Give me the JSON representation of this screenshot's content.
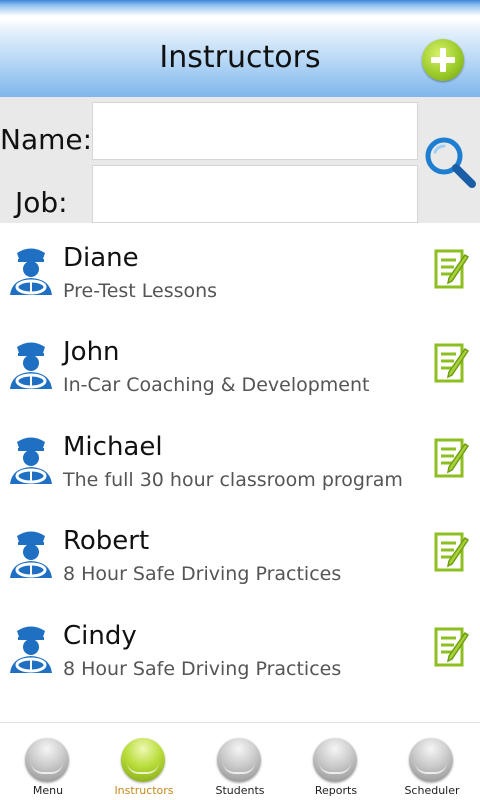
{
  "header": {
    "title": "Instructors",
    "add_icon": "plus-circle-icon"
  },
  "search": {
    "name_label": "Name:",
    "name_value": "",
    "job_label": "Job:",
    "job_value": "",
    "search_icon": "magnifier-icon"
  },
  "instructors": [
    {
      "name": "Diane",
      "description": "Pre-Test Lessons"
    },
    {
      "name": "John",
      "description": "In-Car Coaching & Development"
    },
    {
      "name": "Michael",
      "description": "The full 30 hour classroom program"
    },
    {
      "name": "Robert",
      "description": "8 Hour Safe Driving Practices"
    },
    {
      "name": "Cindy",
      "description": "8 Hour Safe Driving Practices"
    }
  ],
  "tabs": [
    {
      "label": "Menu",
      "active": false
    },
    {
      "label": "Instructors",
      "active": true
    },
    {
      "label": "Students",
      "active": false
    },
    {
      "label": "Reports",
      "active": false
    },
    {
      "label": "Scheduler",
      "active": false
    }
  ],
  "colors": {
    "accent_green": "#9ccc2a",
    "icon_blue": "#1f6fc2",
    "active_tab_text": "#c8871b",
    "header_blue": "#7fb6ec"
  }
}
